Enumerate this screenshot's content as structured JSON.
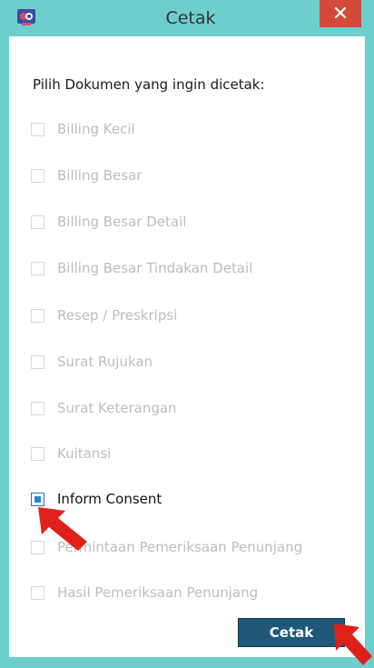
{
  "window": {
    "title": "Cetak",
    "close_icon": "close-icon",
    "app_icon": "app-logo-icon"
  },
  "dialog": {
    "prompt": "Pilih Dokumen yang ingin dicetak:",
    "options": [
      {
        "label": "Billing Kecil",
        "checked": false
      },
      {
        "label": "Billing Besar",
        "checked": false
      },
      {
        "label": "Billing Besar Detail",
        "checked": false
      },
      {
        "label": "Billing Besar Tindakan Detail",
        "checked": false
      },
      {
        "label": "Resep / Preskripsi",
        "checked": false
      },
      {
        "label": "Surat Rujukan",
        "checked": false
      },
      {
        "label": "Surat Keterangan",
        "checked": false
      },
      {
        "label": "Kuitansi",
        "checked": false
      },
      {
        "label": "Inform Consent",
        "checked": true
      },
      {
        "label": "Permintaan Pemeriksaan Penunjang",
        "checked": false
      },
      {
        "label": "Hasil Pemeriksaan Penunjang",
        "checked": false
      }
    ],
    "print_label": "Cetak"
  },
  "colors": {
    "frame": "#6ccfcd",
    "close": "#d24a3a",
    "button": "#1f5879",
    "checkbox_fill": "#1f87d8",
    "annotation_arrow": "#e0201a"
  }
}
